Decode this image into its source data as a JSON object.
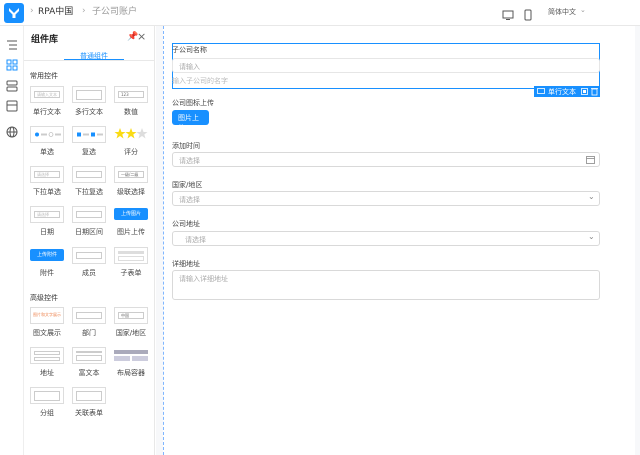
{
  "topbar": {
    "breadcrumb": [
      "RPA中国",
      "子公司账户"
    ],
    "language": "简体中文"
  },
  "panel": {
    "title": "组件库",
    "tab": "普通组件",
    "sections": [
      {
        "title": "常用控件",
        "widgets": [
          {
            "label": "单行文本",
            "preview": "请输入文本"
          },
          {
            "label": "多行文本",
            "preview": ""
          },
          {
            "label": "数值",
            "preview": "123"
          },
          {
            "label": "单选",
            "preview": ""
          },
          {
            "label": "复选",
            "preview": ""
          },
          {
            "label": "评分",
            "preview": ""
          },
          {
            "label": "下拉单选",
            "preview": "请选择"
          },
          {
            "label": "下拉复选",
            "preview": ""
          },
          {
            "label": "级联选择",
            "preview": "一级/二级"
          },
          {
            "label": "日期",
            "preview": "请选择"
          },
          {
            "label": "日期区间",
            "preview": ""
          },
          {
            "label": "图片上传",
            "preview": "上传图片"
          },
          {
            "label": "附件",
            "preview": "上传附件"
          },
          {
            "label": "成员",
            "preview": ""
          },
          {
            "label": "子表单",
            "preview": ""
          }
        ]
      },
      {
        "title": "高级控件",
        "widgets": [
          {
            "label": "图文展示",
            "preview": "图片和文字展示"
          },
          {
            "label": "部门",
            "preview": ""
          },
          {
            "label": "国家/地区",
            "preview": "中国"
          },
          {
            "label": "地址",
            "preview": ""
          },
          {
            "label": "富文本",
            "preview": ""
          },
          {
            "label": "布局容器",
            "preview": ""
          },
          {
            "label": "分组",
            "preview": ""
          },
          {
            "label": "关联表单",
            "preview": ""
          }
        ]
      }
    ]
  },
  "form": {
    "f1": {
      "label": "子公司名称",
      "placeholder": "请输入",
      "hint": "输入子公司的名字"
    },
    "toolbar_label": "单行文本",
    "f2": {
      "label": "公司图标上传",
      "button": "图片上传"
    },
    "f3": {
      "label": "添加时间",
      "placeholder": "请选择"
    },
    "f4": {
      "label": "国家/地区",
      "placeholder": "请选择"
    },
    "f5": {
      "label": "公司地址",
      "placeholder": "请选择"
    },
    "f6": {
      "label": "详细地址",
      "placeholder": "请输入详细地址"
    }
  },
  "colors": {
    "primary": "#1890ff",
    "border": "#d9d9d9",
    "canvas_bg": "#f7f8fa"
  }
}
